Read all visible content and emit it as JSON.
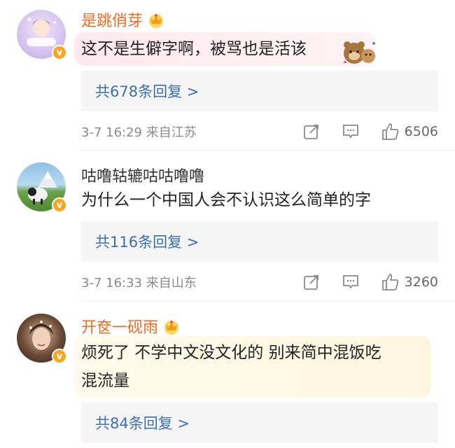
{
  "comments": [
    {
      "username": "是跳俏芽",
      "name_style": "orange",
      "text": "这不是生僻字啊，被骂也是活该",
      "reply_link": "共678条回复 >",
      "time_location": "3-7 16:29 来自江苏",
      "likes": "6506",
      "colors": {
        "bubble_from": "#fde9ef",
        "bubble_to": "#fff3f5"
      }
    },
    {
      "username": "咕噜轱辘咕咕噜噜",
      "name_style": "dark",
      "text": "为什么一个中国人会不认识这么简单的字",
      "reply_link": "共116条回复 >",
      "time_location": "3-7 16:33 来自山东",
      "likes": "3260"
    },
    {
      "username": "开奁一砚雨",
      "name_style": "orange",
      "text_line1": "烦死了 不学中文没文化的 别来简中混饭吃",
      "text_line2": "混流量",
      "reply_link": "共84条回复 >",
      "colors": {
        "bubble_from": "#fffaeb",
        "bubble_to": "#fdf6df"
      }
    }
  ],
  "icons": {
    "share": "share-icon",
    "comment": "comment-icon",
    "like": "thumbs-up-icon",
    "verified": "verified-badge-icon",
    "crown": "crown-icon"
  },
  "avatar_badge_glyph": "v",
  "accent": {
    "link": "#3b6fb5",
    "username_orange": "#f26b21",
    "badge_orange": "#f6a623"
  }
}
